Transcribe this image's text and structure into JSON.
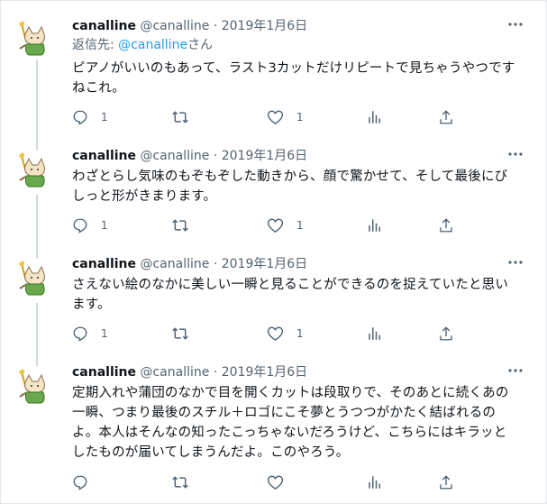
{
  "tweets": [
    {
      "name": "canalline",
      "handle": "@canalline",
      "sep": "·",
      "date": "2019年1月6日",
      "reply_prefix": "返信先: ",
      "reply_handle": "@canalline",
      "reply_suffix": "さん",
      "lines": [
        "ピアノがいいのもあって、ラスト3カットだけリピートで見ちゃうやつです",
        "ねこれ。"
      ],
      "reply_count": "1",
      "like_count": "1"
    },
    {
      "name": "canalline",
      "handle": "@canalline",
      "sep": "·",
      "date": "2019年1月6日",
      "lines": [
        "わざとらし気味のもぞもぞした動きから、顔で驚かせて、そして最後にび",
        "しっと形がきまります。"
      ],
      "reply_count": "1",
      "like_count": "1"
    },
    {
      "name": "canalline",
      "handle": "@canalline",
      "sep": "·",
      "date": "2019年1月6日",
      "lines": [
        "さえない絵のなかに美しい一瞬と見ることができるのを捉えていたと思い",
        "ます。"
      ],
      "reply_count": "1",
      "like_count": "1"
    },
    {
      "name": "canalline",
      "handle": "@canalline",
      "sep": "·",
      "date": "2019年1月6日",
      "lines": [
        "定期入れや蒲団のなかで目を開くカットは段取りで、そのあとに続くあの",
        "一瞬、つまり最後のスチル＋ロゴにこそ夢とうつつがかたく結ばれるの",
        "よ。本人はそんなの知ったこっちゃないだろうけど、こちらにはキラッと",
        "したものが届いてしまうんだよ。このやろう。"
      ],
      "reply_count": "",
      "like_count": ""
    }
  ],
  "icons": {
    "more": "more-dots-icon",
    "reply": "reply-bubble-icon",
    "retweet": "retweet-icon",
    "like": "heart-icon",
    "stats": "analytics-bars-icon",
    "share": "share-upload-icon"
  },
  "colors": {
    "text": "#0f1419",
    "secondary": "#536471",
    "link": "#1d9bf0",
    "thread_line": "#cfd9de",
    "avatar_body": "#6aa84f"
  }
}
